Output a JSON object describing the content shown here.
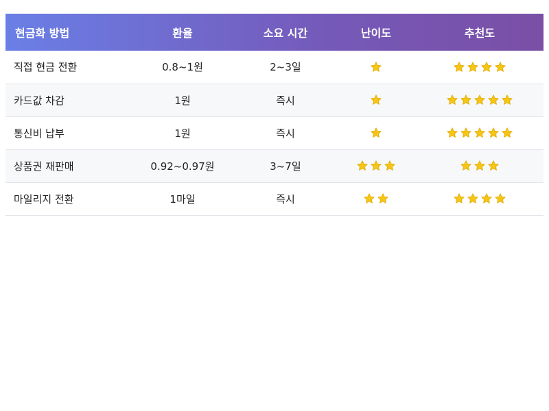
{
  "table": {
    "headers": [
      "현금화 방법",
      "환율",
      "소요 시간",
      "난이도",
      "추천도"
    ],
    "rows": [
      {
        "method": "직접 현금 전환",
        "rate": "0.8~1원",
        "time": "2~3일",
        "difficulty": 1,
        "recommend": 4
      },
      {
        "method": "카드값 차감",
        "rate": "1원",
        "time": "즉시",
        "difficulty": 1,
        "recommend": 5
      },
      {
        "method": "통신비 납부",
        "rate": "1원",
        "time": "즉시",
        "difficulty": 1,
        "recommend": 5
      },
      {
        "method": "상품권 재판매",
        "rate": "0.92~0.97원",
        "time": "3~7일",
        "difficulty": 3,
        "recommend": 3
      },
      {
        "method": "마일리지 전환",
        "rate": "1마일",
        "time": "즉시",
        "difficulty": 2,
        "recommend": 4
      }
    ]
  },
  "icons": {
    "star": "star-icon"
  },
  "colors": {
    "header_gradient_start": "#6a7fe6",
    "header_gradient_end": "#7a4fa5",
    "star_fill": "#f5c518",
    "star_stroke": "#e0a800",
    "row_alt": "#f7f8fa"
  }
}
